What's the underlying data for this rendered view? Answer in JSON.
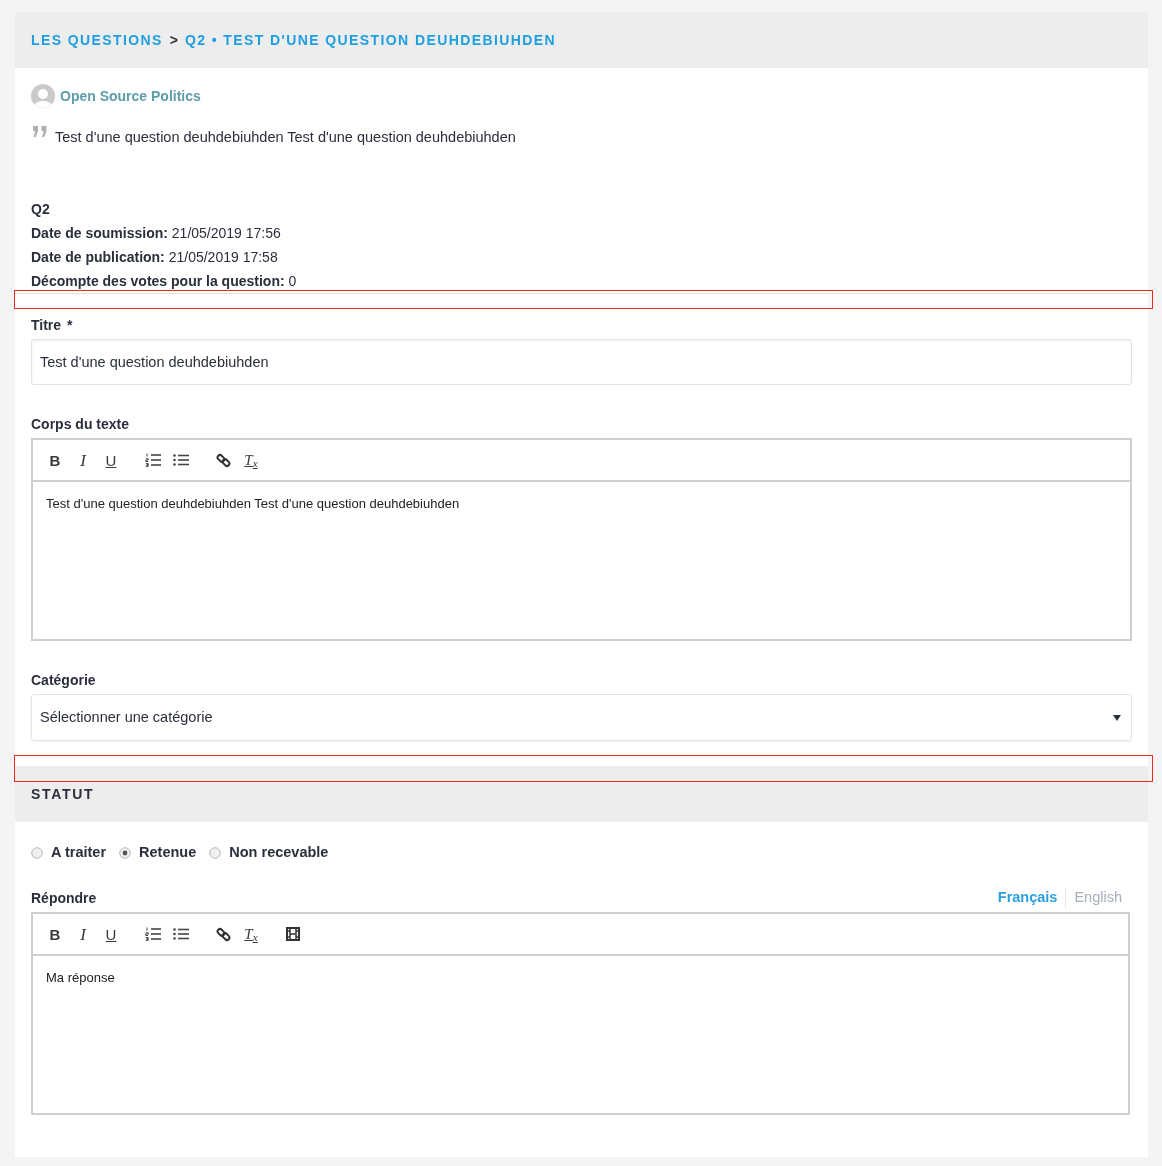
{
  "breadcrumb": [
    {
      "kind": "link",
      "text": "LES QUESTIONS"
    },
    {
      "kind": "separator",
      "text": ">"
    },
    {
      "kind": "link",
      "text": "Q2 • TEST D'UNE QUESTION DEUHDEBIUHDEN"
    }
  ],
  "author": {
    "name": "Open Source Politics"
  },
  "quote": "Test d'une question deuhdebiuhden Test d'une question deuhdebiuhden",
  "reference": "Q2",
  "details": [
    {
      "label": "Date de soumission:",
      "value": "21/05/2019 17:56"
    },
    {
      "label": "Date de publication:",
      "value": "21/05/2019 17:58"
    },
    {
      "label": "Décompte des votes pour la question:",
      "value": "0"
    }
  ],
  "form": {
    "title": {
      "label": "Titre",
      "required_mark": "*",
      "value": "Test d'une question deuhdebiuhden"
    },
    "body": {
      "label": "Corps du texte",
      "toolbar": [
        [
          {
            "kind": "bold",
            "glyph": "B"
          },
          {
            "kind": "italic",
            "glyph": "I"
          },
          {
            "kind": "underline",
            "glyph": "U"
          }
        ],
        [
          {
            "kind": "ordered_list"
          },
          {
            "kind": "bullet_list"
          }
        ],
        [
          {
            "kind": "link"
          },
          {
            "kind": "clean",
            "glyph": "T$_{x}$"
          }
        ]
      ],
      "value": "Test d'une question deuhdebiuhden Test d'une question deuhdebiuhden"
    },
    "category": {
      "label": "Catégorie",
      "value": "Sélectionner une catégorie"
    }
  },
  "status_section": {
    "title": "STATUT",
    "options": [
      {
        "label": "A traiter",
        "selected": false
      },
      {
        "label": "Retenue",
        "selected": true
      },
      {
        "label": "Non recevable",
        "selected": false
      }
    ],
    "answer": {
      "label": "Répondre",
      "languages": [
        {
          "label": "Français",
          "selected": true
        },
        {
          "label": "English",
          "selected": false
        }
      ],
      "toolbar": [
        [
          {
            "kind": "bold",
            "glyph": "B"
          },
          {
            "kind": "italic",
            "glyph": "I"
          },
          {
            "kind": "underline",
            "glyph": "U"
          }
        ],
        [
          {
            "kind": "ordered_list"
          },
          {
            "kind": "bullet_list"
          }
        ],
        [
          {
            "kind": "link"
          },
          {
            "kind": "clean",
            "glyph": "T$_{x}$"
          }
        ],
        [
          {
            "kind": "video"
          }
        ]
      ],
      "value": "Ma réponse"
    }
  }
}
